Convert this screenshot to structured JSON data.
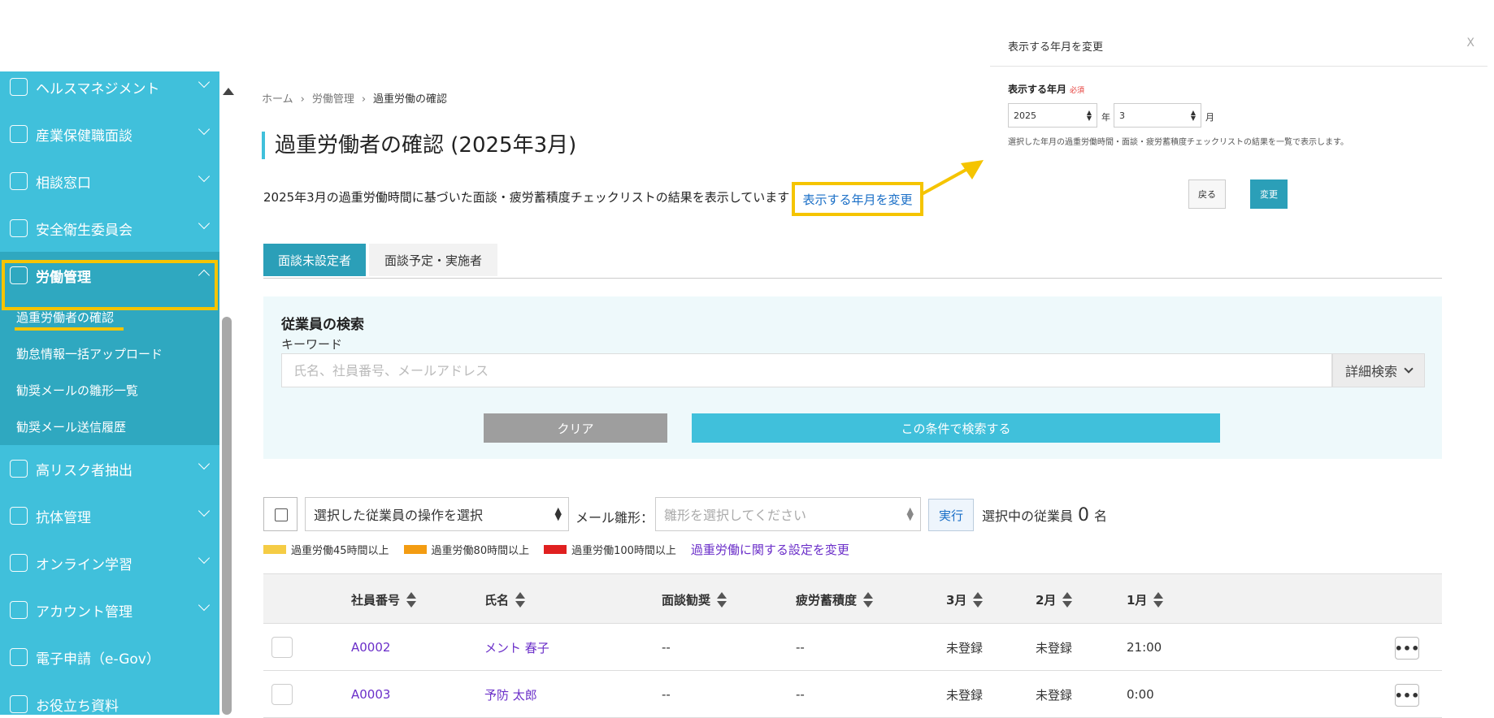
{
  "sidebar": {
    "items": [
      {
        "label": "ヘルスマネジメント",
        "icon": "stethoscope-icon"
      },
      {
        "label": "産業保健職面談",
        "icon": "people-icon"
      },
      {
        "label": "相談窓口",
        "icon": "person-card-icon"
      },
      {
        "label": "安全衛生委員会",
        "icon": "document-icon"
      },
      {
        "label": "労働管理",
        "icon": "calendar-clock-icon"
      },
      {
        "label": "高リスク者抽出",
        "icon": "risk-icon"
      },
      {
        "label": "抗体管理",
        "icon": "syringe-icon"
      },
      {
        "label": "オンライン学習",
        "icon": "graduation-cap-icon"
      },
      {
        "label": "アカウント管理",
        "icon": "gear-icon"
      },
      {
        "label": "電子申請（e-Gov）",
        "icon": "checkbox-icon"
      },
      {
        "label": "お役立ち資料",
        "icon": "book-icon"
      }
    ],
    "submenu": [
      {
        "label": "過重労働者の確認"
      },
      {
        "label": "勤怠情報一括アップロード"
      },
      {
        "label": "勧奨メールの雛形一覧"
      },
      {
        "label": "勧奨メール送信履歴"
      }
    ]
  },
  "breadcrumb": {
    "home": "ホーム",
    "section": "労働管理",
    "current": "過重労働の確認"
  },
  "page": {
    "title": "過重労働者の確認 (2025年3月)",
    "description": "2025年3月の過重労働時間に基づいた面談・疲労蓄積度チェックリストの結果を表示しています",
    "change_link": "表示する年月を変更"
  },
  "tabs": {
    "unset": "面談未設定者",
    "planned": "面談予定・実施者"
  },
  "search": {
    "title": "従業員の検索",
    "keyword_label": "キーワード",
    "placeholder": "氏名、社員番号、メールアドレス",
    "advanced": "詳細検索",
    "clear": "クリア",
    "submit": "この条件で検索する"
  },
  "bulk": {
    "operation_select": "選択した従業員の操作を選択",
    "mail_label": "メール雛形：",
    "template_placeholder": "雛形を選択してください",
    "execute": "実行",
    "selected_prefix": "選択中の従業員",
    "selected_count": "0",
    "selected_suffix": "名"
  },
  "legend": {
    "items": [
      {
        "label": "過重労働45時間以上",
        "color": "#f5cc45"
      },
      {
        "label": "過重労働80時間以上",
        "color": "#f39c12"
      },
      {
        "label": "過重労働100時間以上",
        "color": "#e02020"
      }
    ],
    "settings_link": "過重労働に関する設定を変更"
  },
  "table": {
    "headers": [
      "社員番号",
      "氏名",
      "面談勧奨",
      "疲労蓄積度",
      "3月",
      "2月",
      "1月"
    ],
    "rows": [
      [
        "A0002",
        "メント 春子",
        "--",
        "--",
        "未登録",
        "未登録",
        "21:00"
      ],
      [
        "A0003",
        "予防 太郎",
        "--",
        "--",
        "未登録",
        "未登録",
        "0:00"
      ]
    ],
    "more": "•••"
  },
  "popup": {
    "title": "表示する年月を変更",
    "close": "X",
    "field_label": "表示する年月",
    "required": "必須",
    "year": "2025",
    "year_unit": "年",
    "month": "3",
    "month_unit": "月",
    "help": "選択した年月の過重労働時間・面談・疲労蓄積度チェックリストの結果を一覧で表示します。",
    "back": "戻る",
    "apply": "変更"
  },
  "colors": {
    "accent": "#40c0db",
    "tab_active": "#2b9fb8",
    "highlight": "#f5c400",
    "link": "#1a6fc7"
  }
}
